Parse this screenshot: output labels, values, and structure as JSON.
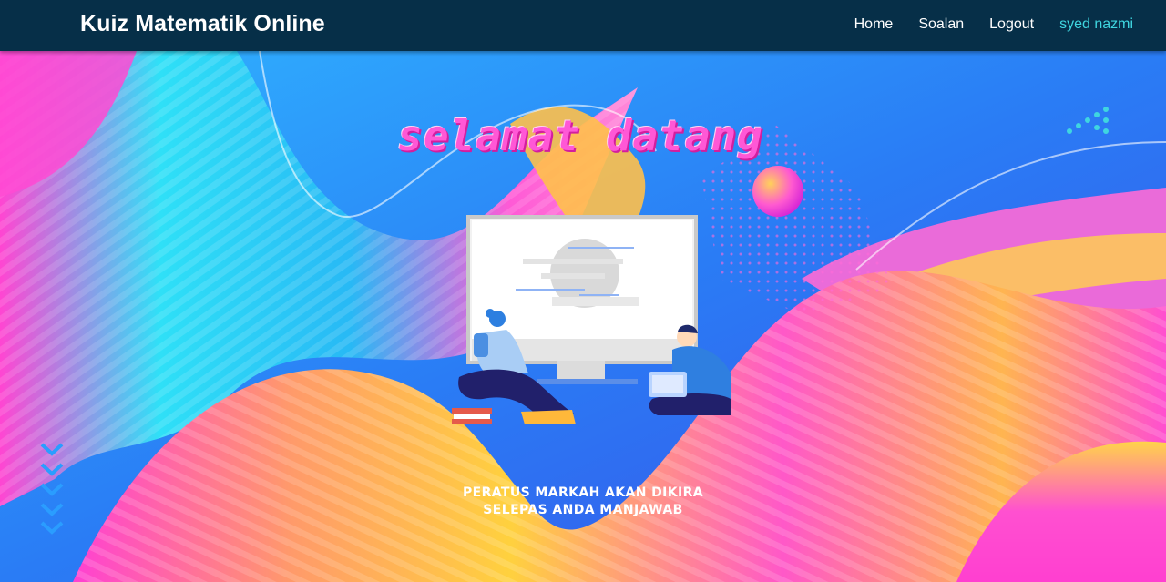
{
  "navbar": {
    "brand": "Kuiz Matematik Online",
    "links": [
      {
        "label": "Home"
      },
      {
        "label": "Soalan"
      },
      {
        "label": "Logout"
      }
    ],
    "user": "syed nazmi"
  },
  "hero": {
    "welcome_text": "selamat datang",
    "caption_line1": "PERATUS MARKAH AKAN DIKIRA",
    "caption_line2": "SELEPAS ANDA MANJAWAB"
  },
  "colors": {
    "navbar_bg": "#062f48",
    "user_link": "#3fd6e0",
    "welcome_text": "#ff58d6",
    "wave_pink": "#ff3fd0",
    "wave_cyan": "#27d6f5",
    "wave_yellow": "#ffd040",
    "background_blue": "#1b8cf0"
  }
}
